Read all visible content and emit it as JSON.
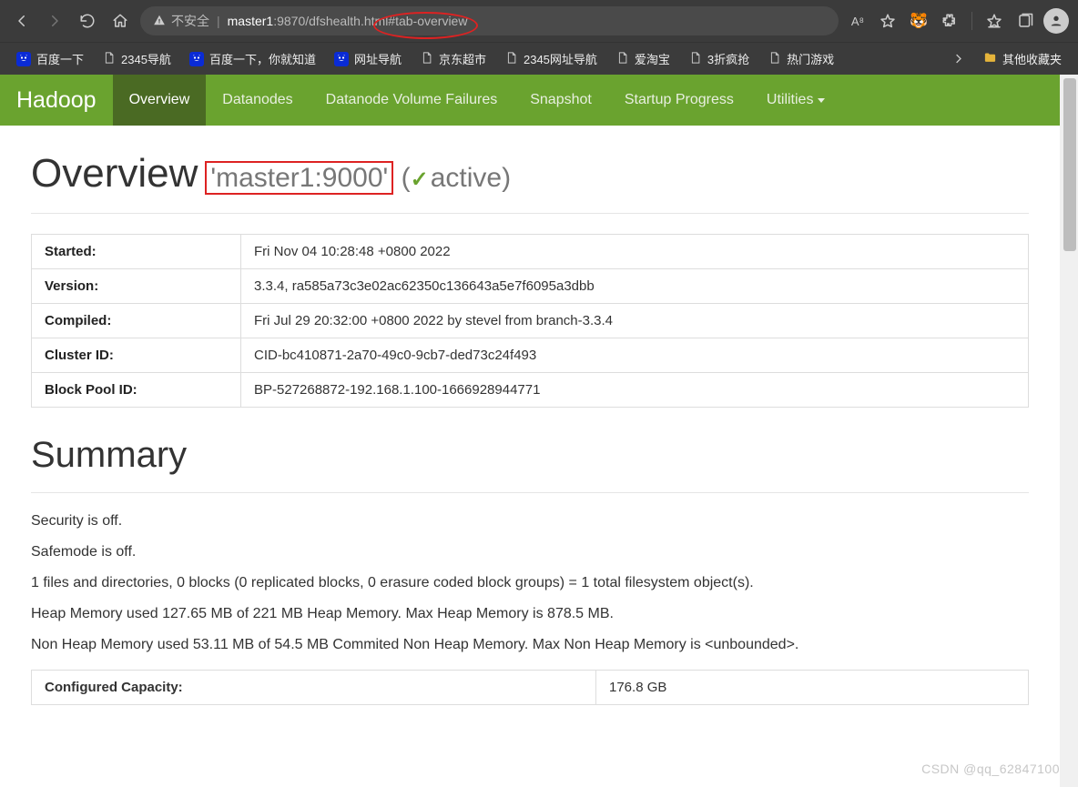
{
  "browser": {
    "insecure_label": "不安全",
    "url_host": "master1",
    "url_rest": ":9870/dfshealth.html#tab-overview",
    "aa_label": "A⁸"
  },
  "bookmarks": {
    "items": [
      {
        "label": "百度一下",
        "type": "ba"
      },
      {
        "label": "2345导航",
        "type": "page"
      },
      {
        "label": "百度一下，你就知道",
        "type": "ba"
      },
      {
        "label": "网址导航",
        "type": "ba"
      },
      {
        "label": "京东超市",
        "type": "page"
      },
      {
        "label": "2345网址导航",
        "type": "page"
      },
      {
        "label": "爱淘宝",
        "type": "page"
      },
      {
        "label": "3折疯抢",
        "type": "page"
      },
      {
        "label": "热门游戏",
        "type": "page"
      }
    ],
    "other": "其他收藏夹"
  },
  "hadoop": {
    "brand": "Hadoop",
    "nav": [
      {
        "label": "Overview",
        "active": true
      },
      {
        "label": "Datanodes"
      },
      {
        "label": "Datanode Volume Failures"
      },
      {
        "label": "Snapshot"
      },
      {
        "label": "Startup Progress"
      },
      {
        "label": "Utilities",
        "dropdown": true
      }
    ]
  },
  "overview": {
    "heading": "Overview",
    "host_label": "'master1:9000'",
    "state": "active",
    "rows": [
      {
        "key": "Started:",
        "val": "Fri Nov 04 10:28:48 +0800 2022"
      },
      {
        "key": "Version:",
        "val": "3.3.4, ra585a73c3e02ac62350c136643a5e7f6095a3dbb"
      },
      {
        "key": "Compiled:",
        "val": "Fri Jul 29 20:32:00 +0800 2022 by stevel from branch-3.3.4"
      },
      {
        "key": "Cluster ID:",
        "val": "CID-bc410871-2a70-49c0-9cb7-ded73c24f493"
      },
      {
        "key": "Block Pool ID:",
        "val": "BP-527268872-192.168.1.100-1666928944771"
      }
    ]
  },
  "summary": {
    "heading": "Summary",
    "lines": [
      "Security is off.",
      "Safemode is off.",
      "1 files and directories, 0 blocks (0 replicated blocks, 0 erasure coded block groups) = 1 total filesystem object(s).",
      "Heap Memory used 127.65 MB of 221 MB Heap Memory. Max Heap Memory is 878.5 MB.",
      "Non Heap Memory used 53.11 MB of 54.5 MB Commited Non Heap Memory. Max Non Heap Memory is <unbounded>."
    ],
    "cap_row": {
      "key": "Configured Capacity:",
      "val": "176.8 GB"
    }
  },
  "watermark": "CSDN @qq_62847100"
}
